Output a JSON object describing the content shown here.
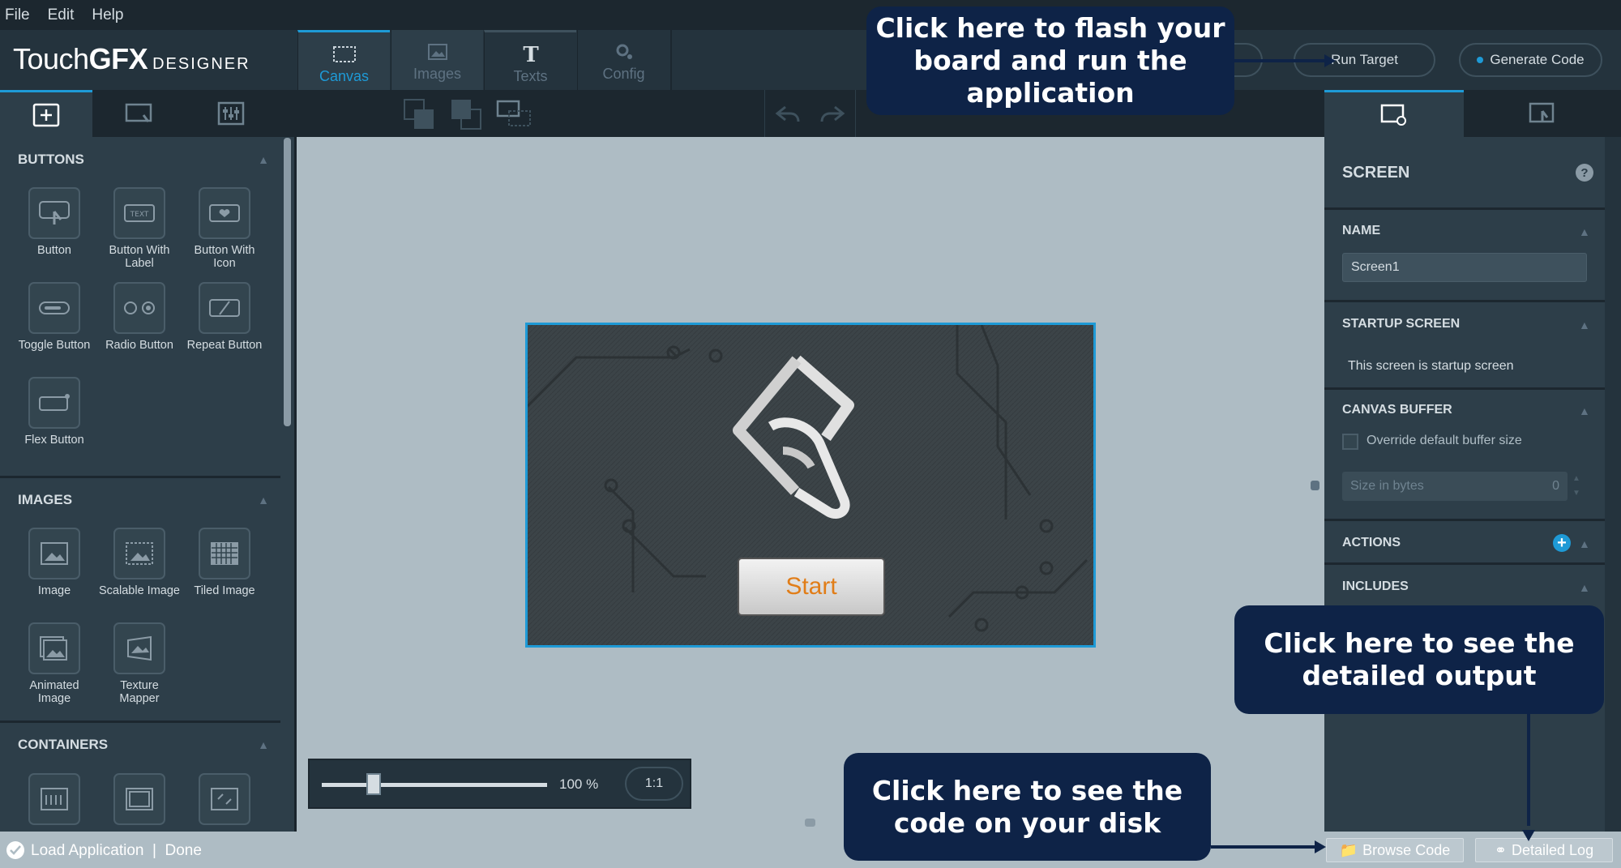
{
  "menu": [
    "File",
    "Edit",
    "Help"
  ],
  "logo": {
    "touch": "Touch",
    "gfx": "GFX",
    "sub": "DESIGNER"
  },
  "tabs": [
    {
      "label": "Canvas",
      "icon": "canvas-icon"
    },
    {
      "label": "Images",
      "icon": "images-icon"
    },
    {
      "label": "Texts",
      "icon": "texts-icon"
    },
    {
      "label": "Config",
      "icon": "config-icon"
    }
  ],
  "header_buttons": {
    "run_target": "Run Target",
    "generate_code": "Generate Code"
  },
  "left_panel": {
    "sections": {
      "buttons": "BUTTONS",
      "images": "IMAGES",
      "containers": "CONTAINERS"
    },
    "button_widgets": [
      "Button",
      "Button With Label",
      "Button With Icon",
      "Toggle Button",
      "Radio Button",
      "Repeat Button",
      "Flex Button"
    ],
    "image_widgets": [
      "Image",
      "Scalable Image",
      "Tiled Image",
      "Animated Image",
      "Texture Mapper"
    ]
  },
  "canvas": {
    "start_label": "Start",
    "zoom_percent": "100 %",
    "zoom_reset": "1:1",
    "zoom_value": 0.2
  },
  "right_panel": {
    "title": "SCREEN",
    "name_label": "NAME",
    "name_value": "Screen1",
    "startup_label": "STARTUP SCREEN",
    "startup_text": "This screen is startup screen",
    "buffer_label": "CANVAS BUFFER",
    "override_text": "Override default buffer size",
    "size_placeholder": "Size in bytes",
    "size_value": "0",
    "actions_label": "ACTIONS",
    "includes_label": "INCLUDES"
  },
  "status": {
    "text": "Load Application  |  Done",
    "browse_code": "Browse Code",
    "detailed_log": "Detailed Log"
  },
  "callouts": {
    "flash": "Click here to flash your board and run the application",
    "output": "Click here to see the detailed output",
    "code": "Click here to see the code on your disk"
  },
  "colors": {
    "accent": "#1e9ad6",
    "callout": "#0e2347",
    "start_text": "#e17d18"
  }
}
